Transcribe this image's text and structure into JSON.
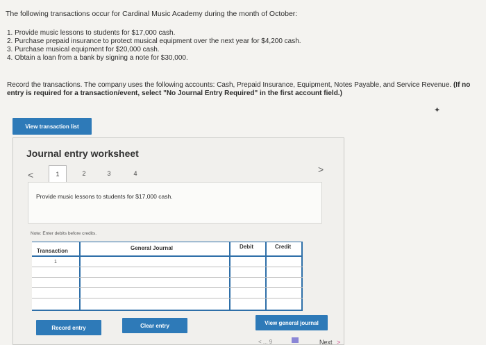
{
  "intro": "The following transactions occur for Cardinal Music Academy during the month of October:",
  "steps": [
    "1. Provide music lessons to students for $17,000 cash.",
    "2. Purchase prepaid insurance to protect musical equipment over the next year for $4,200 cash.",
    "3. Purchase musical equipment for $20,000 cash.",
    "4. Obtain a loan from a bank by signing a note for $30,000."
  ],
  "record_text": "Record the transactions. The company uses the following accounts: Cash, Prepaid Insurance, Equipment, Notes Payable, and Service Revenue.",
  "record_bold": "(If no entry is required for a transaction/event, select \"No Journal Entry Required\" in the first account field.)",
  "view_list_label": "View transaction list",
  "worksheet": {
    "title": "Journal entry worksheet",
    "tabs": [
      "1",
      "2",
      "3",
      "4"
    ],
    "prev_icon": "<",
    "next_icon": ">",
    "description": "Provide music lessons to students for $17,000 cash.",
    "note": "Note: Enter debits before credits.",
    "columns": {
      "transaction": "Transaction",
      "general_journal": "General Journal",
      "debit": "Debit",
      "credit": "Credit"
    },
    "first_transaction": "1",
    "record_label": "Record entry",
    "clear_label": "Clear entry",
    "view_gj_label": "View general journal"
  },
  "footer": {
    "next_label": "Next",
    "next_icon": ">",
    "dots": "< ... 9"
  },
  "colors": {
    "button": "#2e7ab8",
    "grid_line": "#2e6fa8"
  }
}
